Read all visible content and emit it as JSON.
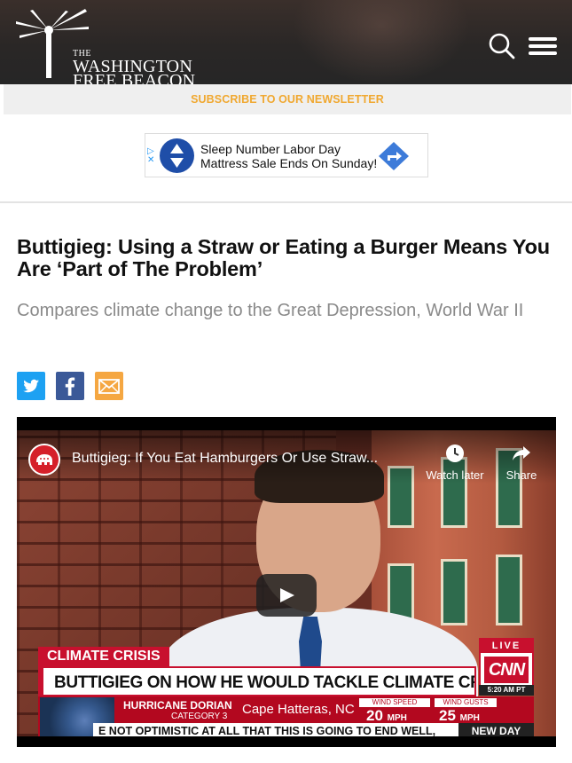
{
  "header": {
    "logo": {
      "the": "THE",
      "line1": "WASHINGTON",
      "line2": "FREE BEACON"
    },
    "icons": {
      "search": "search-icon",
      "menu": "hamburger-menu-icon"
    }
  },
  "subscribe": {
    "label": "SUBSCRIBE TO OUR NEWSLETTER",
    "color": "#f0a830"
  },
  "ad": {
    "choices_icon": "ad-choices-icon",
    "text_line1": "Sleep Number Labor Day",
    "text_line2": "Mattress Sale Ends On Sunday!",
    "cta_icon": "directions-arrow-icon"
  },
  "article": {
    "headline": "Buttigieg: Using a Straw or Eating a Burger Means You Are ‘Part of The Problem’",
    "subhead": "Compares climate change to the Great Depression, World War II",
    "share": [
      {
        "network": "twitter",
        "icon": "twitter-icon",
        "color": "#1da1f2"
      },
      {
        "network": "facebook",
        "icon": "facebook-icon",
        "color": "#3b5998"
      },
      {
        "network": "email",
        "icon": "email-icon",
        "color": "#f5a742"
      }
    ]
  },
  "video": {
    "title": "Buttigieg: If You Eat Hamburgers Or Use Straw...",
    "watch_later": "Watch later",
    "share": "Share",
    "play_icon": "play-icon",
    "lower_third": {
      "tag": "CLIMATE CRISIS",
      "headline": "BUTTIGIEG ON HOW HE WOULD TACKLE CLIMATE CRISIS",
      "live": "LIVE",
      "network": "CNN",
      "time": "5:20 AM PT",
      "storm_name": "HURRICANE DORIAN",
      "storm_category": "CATEGORY 3",
      "location": "Cape Hatteras, NC",
      "wind_speed_label": "WIND SPEED",
      "wind_speed_value": "20",
      "wind_speed_unit": "MPH",
      "wind_gusts_label": "WIND GUSTS",
      "wind_gusts_value": "25",
      "wind_gusts_unit": "MPH",
      "crawl": "E NOT OPTIMISTIC AT ALL THAT THIS IS GOING TO END WELL,",
      "show": "NEW DAY"
    }
  }
}
